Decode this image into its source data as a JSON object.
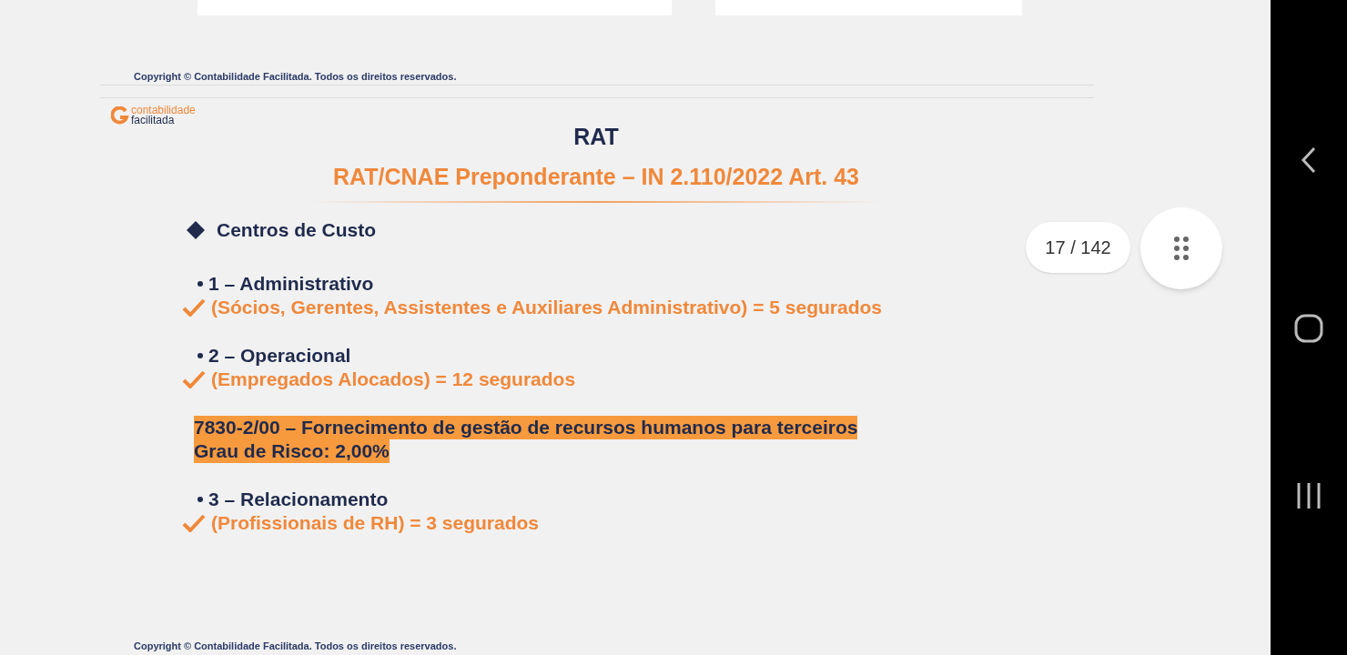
{
  "viewer": {
    "footer_top": "Copyright © Contabilidade Facilitada. Todos os direitos reservados.",
    "page_indicator": "17 / 142"
  },
  "slide": {
    "logo": {
      "line1": "contabilidade",
      "line2": "facilitada"
    },
    "title": "RAT",
    "subtitle": "RAT/CNAE Preponderante – IN 2.110/2022 Art. 43",
    "heading": "Centros de Custo",
    "blocks": [
      {
        "kind": "item",
        "label": "1 – Administrativo",
        "detail": "(Sócios, Gerentes, Assistentes e Auxiliares Administrativo) = 5 segurados"
      },
      {
        "kind": "item",
        "label": "2 – Operacional",
        "detail": "(Empregados Alocados) = 12 segurados"
      },
      {
        "kind": "highlight",
        "lines": [
          "7830-2/00 – Fornecimento de gestão de recursos humanos para terceiros",
          "Grau de Risco: 2,00%"
        ]
      },
      {
        "kind": "item",
        "label": "3 – Relacionamento",
        "detail": "(Profissionais de RH) = 3 segurados"
      }
    ],
    "footer": "Copyright © Contabilidade Facilitada. Todos os direitos reservados."
  }
}
